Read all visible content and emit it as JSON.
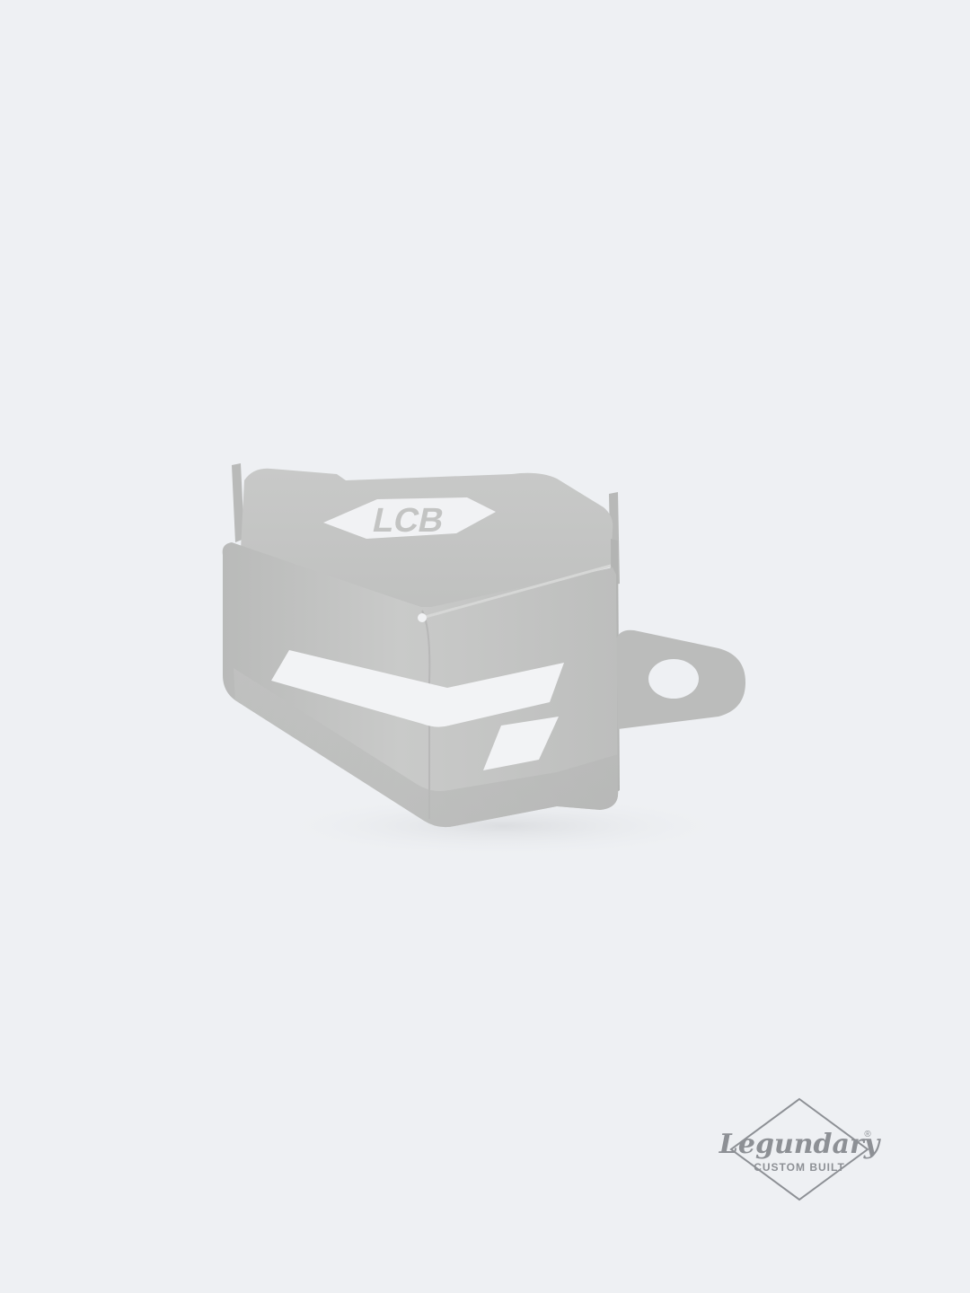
{
  "photo": {
    "background_color": "#eef0f3",
    "product_color": "#c3c4c3",
    "engraving": "LCB"
  },
  "watermark": {
    "brand": "Legundary",
    "registered_mark": "®",
    "tagline": "CUSTOM BUILT",
    "color": "#8d9095"
  }
}
